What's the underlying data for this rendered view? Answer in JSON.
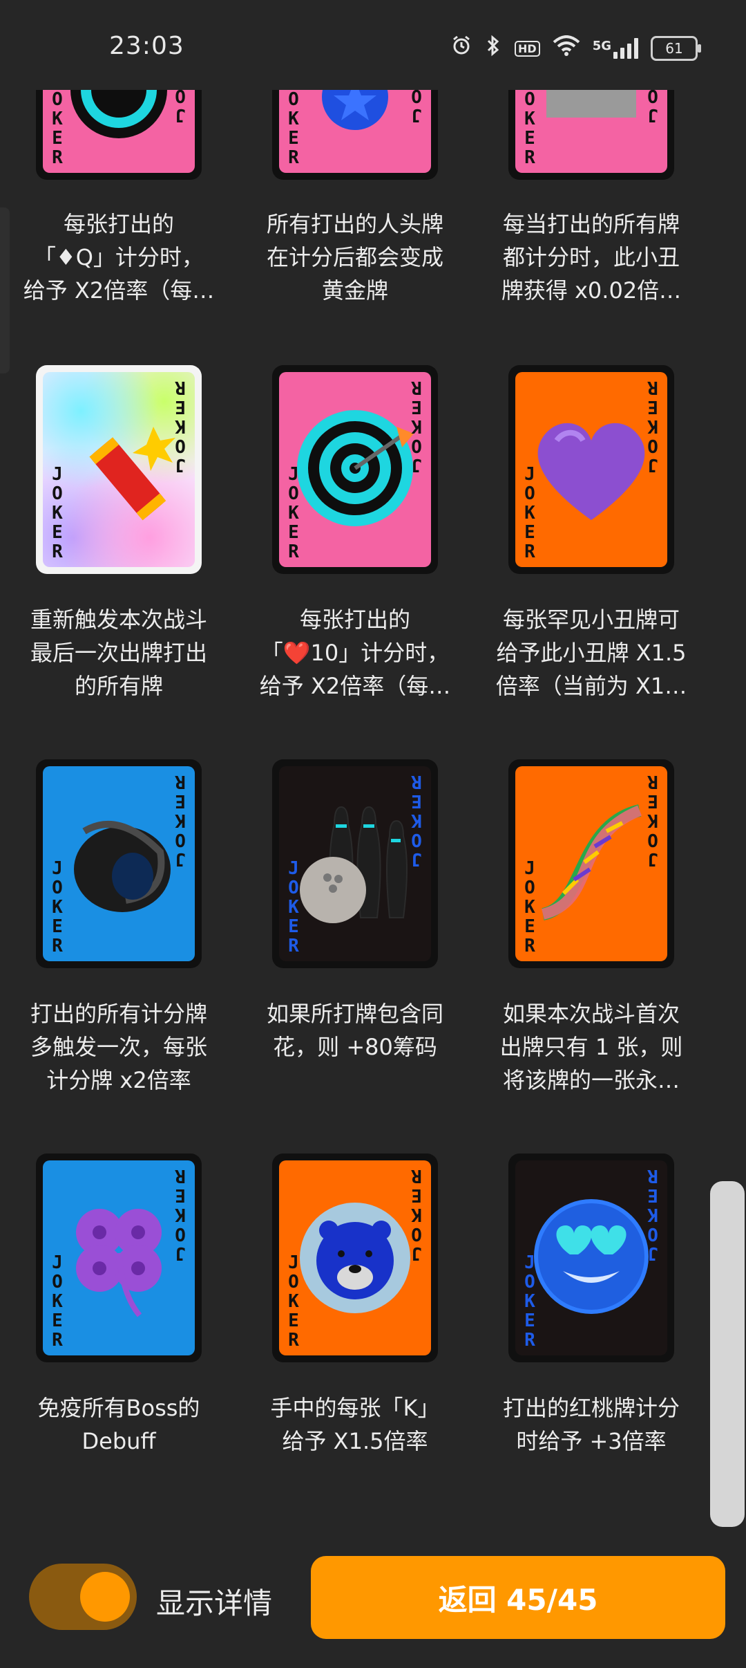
{
  "status_bar": {
    "time": "23:03",
    "battery": "61",
    "network": "5G",
    "hd": "HD",
    "icons": [
      "alarm-icon",
      "bluetooth-icon",
      "hd-icon",
      "wifi-icon",
      "signal-5g-icon",
      "battery-icon"
    ]
  },
  "card_text": [
    "J",
    "O",
    "K",
    "E",
    "R"
  ],
  "cards": [
    {
      "art": "target-icon",
      "bg": "pink",
      "lines": [
        "每张打出的",
        "「♦Q」计分时，",
        "给予 X2倍率（每…"
      ]
    },
    {
      "art": "blue-star-coin-icon",
      "bg": "pink",
      "lines": [
        "所有打出的人头牌",
        "在计分后都会变成",
        "黄金牌"
      ]
    },
    {
      "art": "gray-block-icon",
      "bg": "pink",
      "lines": [
        "每当打出的所有牌",
        "都计分时，此小丑",
        "牌获得 x0.02倍…"
      ]
    },
    {
      "art": "firecracker-icon",
      "bg": "rainbow",
      "lines": [
        "重新触发本次战斗",
        "最后一次出牌打出",
        "的所有牌"
      ]
    },
    {
      "art": "dart-target-icon",
      "bg": "pink",
      "lines": [
        "每张打出的",
        "「❤️10」计分时，",
        "给予 X2倍率（每…"
      ]
    },
    {
      "art": "purple-heart-icon",
      "bg": "orange",
      "lines": [
        "每张罕见小丑牌可",
        "给予此小丑牌 X1.5",
        "倍率（当前为 X1…"
      ]
    },
    {
      "art": "spiral-shell-icon",
      "bg": "blue",
      "lines": [
        "打出的所有计分牌",
        "多触发一次，每张",
        "计分牌 x2倍率"
      ]
    },
    {
      "art": "bowling-icon",
      "bg": "dark",
      "lines": [
        "如果所打牌包含同",
        "花，则 +80筹码"
      ]
    },
    {
      "art": "dna-icon",
      "bg": "orange",
      "lines": [
        "如果本次战斗首次",
        "出牌只有 1 张，则",
        "将该牌的一张永…"
      ]
    },
    {
      "art": "four-leaf-clover-icon",
      "bg": "blue",
      "lines": [
        "免疫所有Boss的",
        "Debuff"
      ]
    },
    {
      "art": "blue-lion-icon",
      "bg": "orange",
      "lines": [
        "手中的每张「K」",
        "给予 X1.5倍率"
      ]
    },
    {
      "art": "heart-eyes-face-icon",
      "bg": "dark",
      "lines": [
        "打出的红桃牌计分",
        "时给予 +3倍率"
      ]
    }
  ],
  "footer": {
    "toggle_label": "显示详情",
    "toggle_on": true,
    "back_button": "返回 45/45"
  },
  "colors": {
    "background": "#262626",
    "accent": "#ff9800",
    "pink": "#f463a3",
    "orange": "#ff6a00",
    "blue": "#1a8fe3",
    "dark": "#1a1414"
  }
}
